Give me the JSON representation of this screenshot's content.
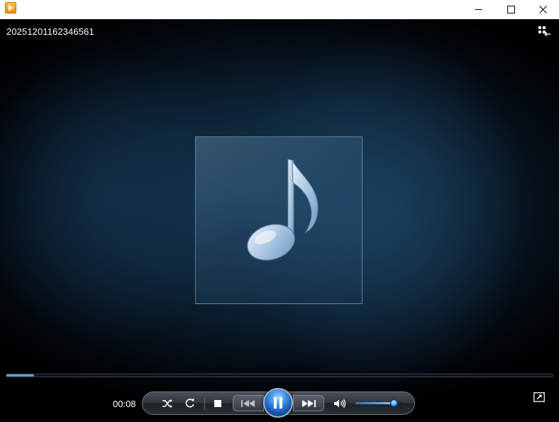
{
  "window": {
    "title": "",
    "controls": {
      "minimize_icon": "minimize-icon",
      "maximize_icon": "maximize-icon",
      "close_icon": "close-icon"
    }
  },
  "media": {
    "title": "20251201162346561",
    "album_art_icon": "music-note-icon"
  },
  "playback": {
    "elapsed": "00:08",
    "seek_progress": 0.05,
    "volume_level": 0.83,
    "state": "playing"
  },
  "icons": {
    "switch_library": "switch-to-library-icon",
    "shuffle": "shuffle-icon",
    "repeat": "repeat-icon",
    "stop": "stop-icon",
    "previous": "previous-icon",
    "pause": "pause-icon",
    "next": "next-icon",
    "mute": "speaker-icon",
    "fullscreen": "fullscreen-icon"
  },
  "colors": {
    "accent": "#3f90e0",
    "seek_fill": "#4a9ae0",
    "video_background": "#0c2335"
  }
}
